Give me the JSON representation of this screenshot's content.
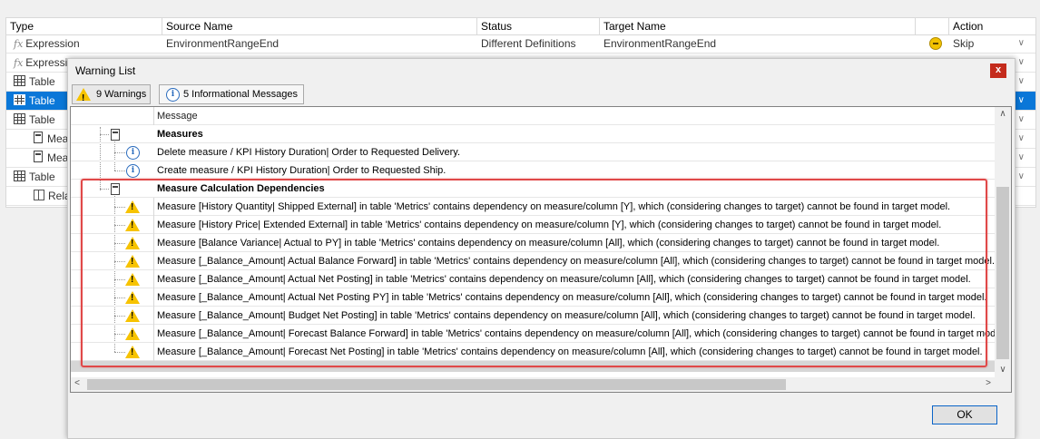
{
  "grid": {
    "headers": {
      "type": "Type",
      "source": "Source Name",
      "status": "Status",
      "target": "Target Name",
      "action": "Action"
    },
    "rows": [
      {
        "type": "Expression",
        "source": "EnvironmentRangeEnd",
        "status": "Different Definitions",
        "target": "EnvironmentRangeEnd",
        "action": "Skip"
      },
      {
        "type": "Expressio",
        "source": "",
        "status": "",
        "target": "",
        "action": ""
      },
      {
        "type": "Table",
        "source": "",
        "status": "",
        "target": "",
        "action": ""
      },
      {
        "type": "Table",
        "source": "",
        "status": "",
        "target": "",
        "action": ""
      },
      {
        "type": "Table",
        "source": "",
        "status": "",
        "target": "",
        "action": ""
      },
      {
        "type": "Meas",
        "source": "",
        "status": "",
        "target": "",
        "action": ""
      },
      {
        "type": "Meas",
        "source": "",
        "status": "",
        "target": "",
        "action": ""
      },
      {
        "type": "Table",
        "source": "",
        "status": "",
        "target": "",
        "action": ""
      },
      {
        "type": "Relat",
        "source": "",
        "status": "",
        "target": "",
        "action": ""
      }
    ]
  },
  "dialog": {
    "title": "Warning List",
    "close": "x",
    "tabs": {
      "warnings": "9 Warnings",
      "info": "5 Informational Messages"
    },
    "column_header": "Message",
    "groups": {
      "measures": "Measures",
      "dependencies": "Measure Calculation Dependencies"
    },
    "info_messages": [
      "Delete measure / KPI History Duration| Order to Requested Delivery.",
      "Create measure / KPI History Duration| Order to Requested Ship."
    ],
    "warnings": [
      "Measure [History Quantity| Shipped External] in table 'Metrics' contains dependency on measure/column [Y], which (considering changes to target) cannot be found in target model.",
      "Measure [History Price| Extended External] in table 'Metrics' contains dependency on measure/column [Y], which (considering changes to target) cannot be found in target model.",
      "Measure [Balance Variance| Actual to PY] in table 'Metrics' contains dependency on measure/column [All], which (considering changes to target) cannot be found in target model.",
      "Measure [_Balance_Amount| Actual Balance Forward] in table 'Metrics' contains dependency on measure/column [All], which (considering changes to target) cannot be found in target model.",
      "Measure [_Balance_Amount| Actual Net Posting] in table 'Metrics' contains dependency on measure/column [All], which (considering changes to target) cannot be found in target model.",
      "Measure [_Balance_Amount| Actual Net Posting PY] in table 'Metrics' contains dependency on measure/column [All], which (considering changes to target) cannot be found in target model.",
      "Measure [_Balance_Amount| Budget Net Posting] in table 'Metrics' contains dependency on measure/column [All], which (considering changes to target) cannot be found in target model.",
      "Measure [_Balance_Amount| Forecast Balance Forward] in table 'Metrics' contains dependency on measure/column [All], which (considering changes to target) cannot be found in target model.",
      "Measure [_Balance_Amount| Forecast Net Posting] in table 'Metrics' contains dependency on measure/column [All], which (considering changes to target) cannot be found in target model."
    ],
    "ok": "OK"
  },
  "colors": {
    "selection": "#0a77d8",
    "highlight_box": "#e04848",
    "warning": "#f7c300",
    "info": "#2a6bbd"
  }
}
